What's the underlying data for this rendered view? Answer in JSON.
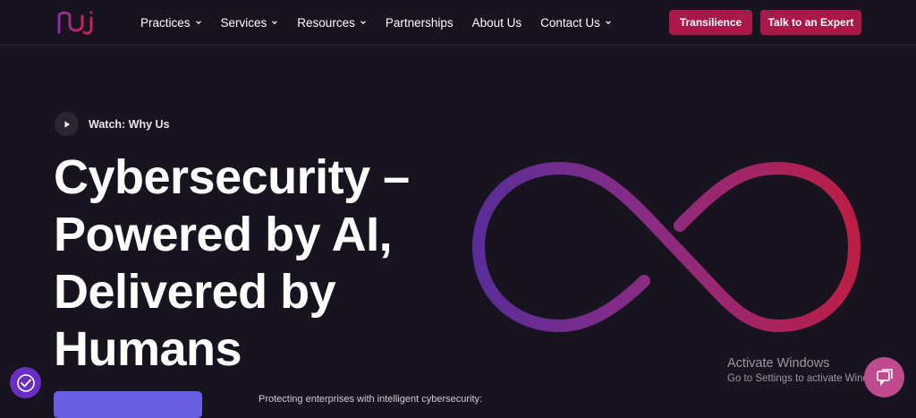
{
  "header": {
    "logo_icon": "nu-logo-icon",
    "nav": [
      {
        "label": "Practices",
        "dropdown": true
      },
      {
        "label": "Services",
        "dropdown": true
      },
      {
        "label": "Resources",
        "dropdown": true
      },
      {
        "label": "Partnerships",
        "dropdown": false
      },
      {
        "label": "About Us",
        "dropdown": false
      },
      {
        "label": "Contact Us",
        "dropdown": true
      }
    ],
    "buttons": {
      "transilience": "Transilience",
      "expert": "Talk to an Expert"
    }
  },
  "hero": {
    "watch_label": "Watch: Why Us",
    "title": "Cybersecurity – Powered by AI, Delivered by Humans",
    "tagline": "Protecting enterprises with intelligent cybersecurity:"
  },
  "overlay": {
    "activate_title": "Activate Windows",
    "activate_sub": "Go to Settings to activate Windows."
  },
  "colors": {
    "background": "#17131f",
    "accent_red": "#a8194a",
    "accent_purple": "#6a2ec4",
    "cta_blue": "#6a5fe0"
  },
  "icons": [
    "play-icon",
    "chevron-down-icon",
    "infinity-graphic",
    "accessibility-icon",
    "chat-icon"
  ]
}
